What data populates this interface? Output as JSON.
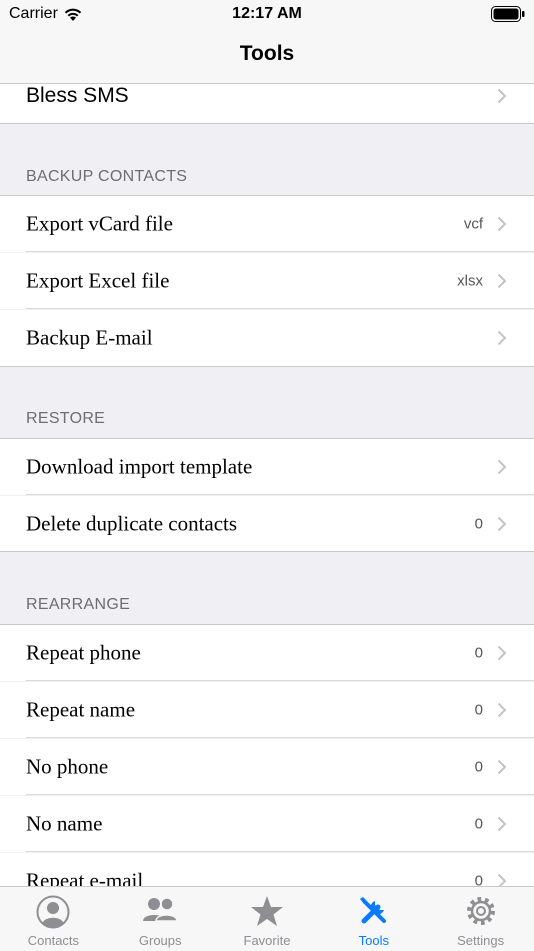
{
  "status_bar": {
    "carrier": "Carrier",
    "time": "12:17 AM"
  },
  "nav": {
    "title": "Tools"
  },
  "top_row": {
    "label": "Bless SMS"
  },
  "sections": {
    "backup": {
      "header": "BACKUP CONTACTS",
      "rows": [
        {
          "label": "Export vCard file",
          "detail": "vcf"
        },
        {
          "label": "Export Excel file",
          "detail": "xlsx"
        },
        {
          "label": "Backup E-mail",
          "detail": ""
        }
      ]
    },
    "restore": {
      "header": "RESTORE",
      "rows": [
        {
          "label": "Download import template",
          "detail": ""
        },
        {
          "label": "Delete duplicate contacts",
          "detail": "0"
        }
      ]
    },
    "rearrange": {
      "header": "REARRANGE",
      "rows": [
        {
          "label": "Repeat phone",
          "detail": "0"
        },
        {
          "label": "Repeat name",
          "detail": "0"
        },
        {
          "label": "No phone",
          "detail": "0"
        },
        {
          "label": "No name",
          "detail": "0"
        },
        {
          "label": "Repeat e-mail",
          "detail": "0"
        }
      ]
    }
  },
  "tab_bar": {
    "active": "tools",
    "tabs": [
      {
        "label": "Contacts",
        "icon": "person-circle-icon"
      },
      {
        "label": "Groups",
        "icon": "people-icon"
      },
      {
        "label": "Favorite",
        "icon": "star-icon"
      },
      {
        "label": "Tools",
        "icon": "wrench-screwdriver-icon"
      },
      {
        "label": "Settings",
        "icon": "gear-icon"
      }
    ]
  },
  "colors": {
    "accent": "#0a7aff",
    "background": "#efeff4",
    "inactive": "#8e8e93"
  }
}
